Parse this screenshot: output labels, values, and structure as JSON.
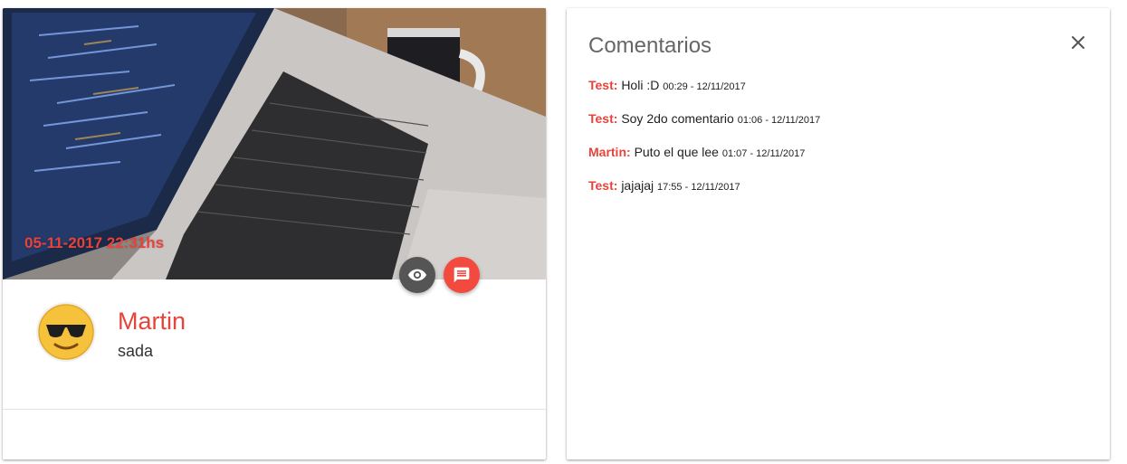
{
  "post": {
    "date": "05-11-2017 22:31hs",
    "author": "Martin",
    "text": "sada",
    "icons": {
      "view": "eye-icon",
      "comment": "comment-icon",
      "avatar": "sunglasses-emoji-icon"
    },
    "colors": {
      "accent": "#e8433a",
      "view_button": "#555555",
      "comment_button": "#f24a3f"
    }
  },
  "comments_panel": {
    "title": "Comentarios",
    "close_icon": "close-icon",
    "items": [
      {
        "author": "Test:",
        "text": "Holi :D",
        "time": "00:29 - 12/11/2017"
      },
      {
        "author": "Test:",
        "text": "Soy 2do comentario",
        "time": "01:06 - 12/11/2017"
      },
      {
        "author": "Martin:",
        "text": "Puto el que lee",
        "time": "01:07 - 12/11/2017"
      },
      {
        "author": "Test:",
        "text": "jajajaj",
        "time": "17:55 - 12/11/2017"
      }
    ]
  }
}
